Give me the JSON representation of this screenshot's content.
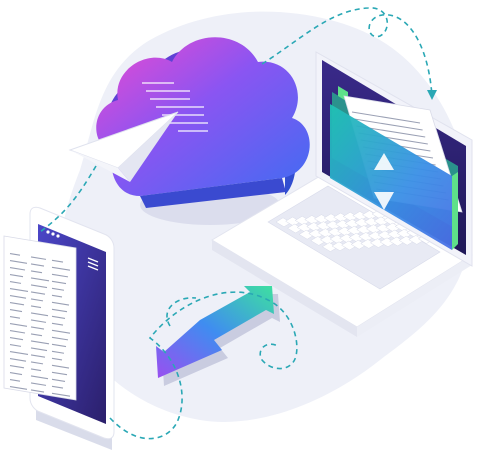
{
  "illustration": {
    "subject": "cloud-file-sync-between-phone-and-laptop",
    "colors": {
      "blob_background": "#eef0f8",
      "device_body": "#ffffff",
      "device_shadow": "#dde0ec",
      "screen_dark": "#2b1f6b",
      "cloud_top": "#ee49d0",
      "cloud_mid": "#8a55f2",
      "cloud_bottom": "#3f6cf2",
      "arrow_start": "#9a4ff0",
      "arrow_end": "#3ee0a0",
      "folder_teal": "#1fc2b2",
      "folder_blue": "#4a6fe6",
      "folder_green": "#5ee08a",
      "dashed_path": "#2aa8b5",
      "paper": "#ffffff",
      "paper_lines": "#9aa0b4"
    },
    "icons": [
      "cloud-icon",
      "laptop-icon",
      "smartphone-icon",
      "folder-icon",
      "document-icon",
      "paper-plane-icon",
      "transfer-arrows-icon",
      "upload-download-arrows-icon"
    ]
  }
}
